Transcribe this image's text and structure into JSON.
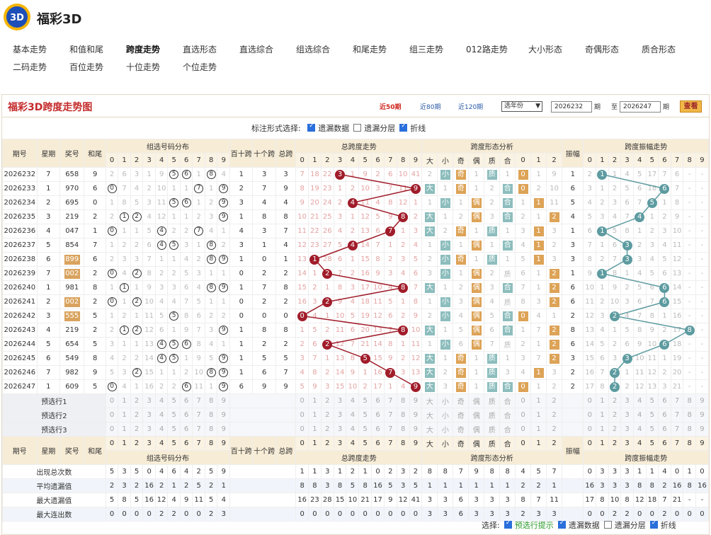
{
  "site": {
    "name": "福彩3D",
    "logo_label": "3D"
  },
  "nav": [
    [
      {
        "label": "基本走势"
      },
      {
        "label": "和值和尾"
      },
      {
        "label": "跨度走势",
        "active": true
      },
      {
        "label": "直选形态"
      },
      {
        "label": "直选综合"
      },
      {
        "label": "组选综合"
      },
      {
        "label": "和尾走势"
      },
      {
        "label": "组三走势"
      },
      {
        "label": "012路走势"
      },
      {
        "label": "大小形态"
      },
      {
        "label": "奇偶形态"
      },
      {
        "label": "质合形态"
      }
    ],
    [
      {
        "label": "二码走势"
      },
      {
        "label": "百位走势"
      },
      {
        "label": "十位走势"
      },
      {
        "label": "个位走势"
      }
    ]
  ],
  "panel": {
    "title": "福彩3D跨度走势图",
    "ranges": [
      "近50期",
      "近80期",
      "近120期"
    ],
    "active_range": "近50期",
    "year_select": "选年份",
    "from_issue": "2026232",
    "from_label": "期",
    "to_label": "至",
    "to_issue": "2026247",
    "to_suffix": "期",
    "view_btn": "查看",
    "mark_label": "标注形式选择:",
    "checks": [
      {
        "label": "遗漏数据",
        "checked": true
      },
      {
        "label": "遗漏分层",
        "checked": false
      },
      {
        "label": "折线",
        "checked": true
      }
    ]
  },
  "headers": {
    "issue": "期号",
    "week": "星期",
    "num": "奖号",
    "sumtail": "和尾",
    "group": "组选号码分布",
    "bs": "百十跨",
    "bg": "十个跨",
    "total": "总跨",
    "zkt": "总跨度走势",
    "shape": "跨度形态分析",
    "amp": "振幅",
    "ampt": "跨度振幅走势",
    "shape_cols": [
      "大",
      "小",
      "奇",
      "偶",
      "质",
      "合",
      "0",
      "1",
      "2"
    ],
    "digits": [
      "0",
      "1",
      "2",
      "3",
      "4",
      "5",
      "6",
      "7",
      "8",
      "9"
    ]
  },
  "rows": [
    {
      "issue": "2026232",
      "week": "7",
      "num": "658",
      "tail": "9",
      "grp": [
        "2",
        "6",
        "3",
        "1",
        "9",
        "⑤",
        "⑥",
        "1",
        "⑧",
        "4"
      ],
      "bs": "1",
      "bg": "3",
      "tot": "3",
      "zk": [
        "7",
        "18",
        "22",
        "●3",
        "1",
        "9",
        "2",
        "6",
        "10",
        "41"
      ],
      "shp": [
        "2",
        "小",
        "奇",
        "1",
        "质",
        "1",
        "0",
        "1",
        "9"
      ],
      "amp": "1",
      "ampz": [
        "2",
        "●1",
        "1",
        "4",
        "5",
        "17",
        "7",
        "6",
        "-",
        "-"
      ]
    },
    {
      "issue": "2026233",
      "week": "1",
      "num": "970",
      "tail": "6",
      "grp": [
        "⓪",
        "7",
        "4",
        "2",
        "10",
        "1",
        "1",
        "⑦",
        "1",
        "⑨"
      ],
      "bs": "2",
      "bg": "7",
      "tot": "9",
      "zk": [
        "8",
        "19",
        "23",
        "1",
        "2",
        "10",
        "3",
        "7",
        "11",
        "●9"
      ],
      "shp": [
        "大",
        "1",
        "奇",
        "1",
        "2",
        "合",
        "0",
        "2",
        "10"
      ],
      "amp": "6",
      "ampz": [
        "3",
        "1",
        "2",
        "5",
        "6",
        "18",
        "●6",
        "7",
        "-",
        "-"
      ]
    },
    {
      "issue": "2026234",
      "week": "2",
      "num": "695",
      "tail": "0",
      "grp": [
        "1",
        "8",
        "5",
        "3",
        "11",
        "⑤",
        "⑥",
        "1",
        "2",
        "⑨"
      ],
      "bs": "3",
      "bg": "4",
      "tot": "4",
      "zk": [
        "9",
        "20",
        "24",
        "2",
        "●4",
        "11",
        "4",
        "8",
        "12",
        "1"
      ],
      "shp": [
        "1",
        "小",
        "1",
        "偶",
        "2",
        "合",
        "1",
        "1",
        "11"
      ],
      "amp": "5",
      "ampz": [
        "4",
        "2",
        "3",
        "6",
        "7",
        "●5",
        "1",
        "8",
        "-",
        "-"
      ]
    },
    {
      "issue": "2026235",
      "week": "3",
      "num": "219",
      "tail": "2",
      "grp": [
        "2",
        "①",
        "②",
        "4",
        "12",
        "1",
        "1",
        "2",
        "3",
        "⑨"
      ],
      "bs": "1",
      "bg": "8",
      "tot": "8",
      "zk": [
        "10",
        "21",
        "25",
        "3",
        "1",
        "12",
        "5",
        "9",
        "●8",
        "2"
      ],
      "shp": [
        "大",
        "1",
        "2",
        "偶",
        "3",
        "合",
        "2",
        "1",
        "2"
      ],
      "amp": "4",
      "ampz": [
        "5",
        "3",
        "4",
        "7",
        "●4",
        "1",
        "2",
        "9",
        "-",
        "-"
      ]
    },
    {
      "issue": "2026236",
      "week": "4",
      "num": "047",
      "tail": "1",
      "grp": [
        "⓪",
        "1",
        "1",
        "5",
        "④",
        "2",
        "2",
        "⑦",
        "4",
        "1"
      ],
      "bs": "4",
      "bg": "3",
      "tot": "7",
      "zk": [
        "11",
        "22",
        "26",
        "4",
        "2",
        "13",
        "6",
        "●7",
        "1",
        "3"
      ],
      "shp": [
        "大",
        "2",
        "奇",
        "1",
        "质",
        "1",
        "3",
        "1",
        "3"
      ],
      "amp": "1",
      "ampz": [
        "6",
        "●1",
        "5",
        "8",
        "1",
        "2",
        "3",
        "10",
        "-",
        "-"
      ]
    },
    {
      "issue": "2026237",
      "week": "5",
      "num": "854",
      "tail": "7",
      "grp": [
        "1",
        "2",
        "2",
        "6",
        "④",
        "⑤",
        "3",
        "1",
        "⑧",
        "2"
      ],
      "bs": "3",
      "bg": "1",
      "tot": "4",
      "zk": [
        "12",
        "23",
        "27",
        "5",
        "●4",
        "14",
        "7",
        "1",
        "2",
        "4"
      ],
      "shp": [
        "1",
        "小",
        "1",
        "偶",
        "1",
        "合",
        "4",
        "1",
        "2"
      ],
      "amp": "3",
      "ampz": [
        "7",
        "1",
        "6",
        "●3",
        "2",
        "3",
        "4",
        "11",
        "-",
        "-"
      ]
    },
    {
      "issue": "2026238",
      "week": "6",
      "num": "899",
      "tail": "6",
      "grp": [
        "2",
        "3",
        "3",
        "7",
        "1",
        "1",
        "4",
        "2",
        "⑧",
        "⑨"
      ],
      "bs": "1",
      "bg": "0",
      "tot": "1",
      "zk": [
        "13",
        "●1",
        "28",
        "6",
        "1",
        "15",
        "8",
        "2",
        "3",
        "5"
      ],
      "shp": [
        "2",
        "小",
        "奇",
        "1",
        "质",
        "1",
        "5",
        "1",
        "3"
      ],
      "amp": "3",
      "ampz": [
        "8",
        "2",
        "7",
        "●3",
        "3",
        "4",
        "5",
        "12",
        "-",
        "-"
      ],
      "zu": true
    },
    {
      "issue": "2026239",
      "week": "7",
      "num": "002",
      "tail": "2",
      "grp": [
        "⓪",
        "4",
        "②",
        "8",
        "2",
        "2",
        "5",
        "3",
        "1",
        "1"
      ],
      "bs": "0",
      "bg": "2",
      "tot": "2",
      "zk": [
        "14",
        "1",
        "●2",
        "7",
        "2",
        "16",
        "9",
        "3",
        "4",
        "6"
      ],
      "shp": [
        "3",
        "小",
        "1",
        "偶",
        "2",
        "质",
        "6",
        "1",
        "2"
      ],
      "amp": "1",
      "ampz": [
        "9",
        "●1",
        "8",
        "1",
        "4",
        "5",
        "6",
        "13",
        "-",
        "-"
      ],
      "zu": true
    },
    {
      "issue": "2026240",
      "week": "1",
      "num": "981",
      "tail": "8",
      "grp": [
        "1",
        "①",
        "1",
        "9",
        "3",
        "3",
        "6",
        "4",
        "⑧",
        "⑨"
      ],
      "bs": "1",
      "bg": "7",
      "tot": "8",
      "zk": [
        "15",
        "2",
        "1",
        "8",
        "3",
        "17",
        "10",
        "4",
        "●8",
        "7"
      ],
      "shp": [
        "大",
        "1",
        "2",
        "偶",
        "3",
        "合",
        "7",
        "1",
        "2"
      ],
      "amp": "6",
      "ampz": [
        "10",
        "1",
        "9",
        "2",
        "5",
        "6",
        "●6",
        "14",
        "-",
        "-"
      ]
    },
    {
      "issue": "2026241",
      "week": "2",
      "num": "002",
      "tail": "2",
      "grp": [
        "⓪",
        "1",
        "②",
        "10",
        "4",
        "4",
        "7",
        "5",
        "1",
        "1"
      ],
      "bs": "0",
      "bg": "2",
      "tot": "2",
      "zk": [
        "16",
        "3",
        "●2",
        "9",
        "4",
        "18",
        "11",
        "5",
        "1",
        "8"
      ],
      "shp": [
        "1",
        "小",
        "3",
        "偶",
        "4",
        "质",
        "8",
        "3",
        "2"
      ],
      "amp": "6",
      "ampz": [
        "11",
        "2",
        "10",
        "3",
        "6",
        "7",
        "●6",
        "15",
        "-",
        "-"
      ],
      "zu": true
    },
    {
      "issue": "2026242",
      "week": "3",
      "num": "555",
      "tail": "5",
      "grp": [
        "1",
        "2",
        "1",
        "11",
        "5",
        "⑤",
        "8",
        "6",
        "2",
        "2"
      ],
      "bs": "0",
      "bg": "0",
      "tot": "0",
      "zk": [
        "●0",
        "4",
        "1",
        "10",
        "5",
        "19",
        "12",
        "6",
        "2",
        "9"
      ],
      "shp": [
        "2",
        "小",
        "4",
        "偶",
        "5",
        "合",
        "0",
        "4",
        "1"
      ],
      "amp": "2",
      "ampz": [
        "12",
        "3",
        "●2",
        "4",
        "7",
        "8",
        "1",
        "16",
        "-",
        "-"
      ],
      "zu": true
    },
    {
      "issue": "2026243",
      "week": "4",
      "num": "219",
      "tail": "2",
      "grp": [
        "2",
        "①",
        "②",
        "12",
        "6",
        "1",
        "9",
        "7",
        "3",
        "⑨"
      ],
      "bs": "1",
      "bg": "8",
      "tot": "8",
      "zk": [
        "1",
        "5",
        "2",
        "11",
        "6",
        "20",
        "13",
        "7",
        "●8",
        "10"
      ],
      "shp": [
        "大",
        "1",
        "5",
        "偶",
        "6",
        "合",
        "1",
        "7",
        "2"
      ],
      "amp": "8",
      "ampz": [
        "13",
        "4",
        "1",
        "5",
        "8",
        "9",
        "2",
        "17",
        "●8",
        "-"
      ]
    },
    {
      "issue": "2026244",
      "week": "5",
      "num": "654",
      "tail": "5",
      "grp": [
        "3",
        "1",
        "1",
        "13",
        "④",
        "⑤",
        "⑥",
        "8",
        "4",
        "1"
      ],
      "bs": "1",
      "bg": "2",
      "tot": "2",
      "zk": [
        "2",
        "6",
        "●2",
        "12",
        "7",
        "21",
        "14",
        "8",
        "1",
        "11"
      ],
      "shp": [
        "1",
        "小",
        "6",
        "偶",
        "7",
        "质",
        "2",
        "1",
        "2"
      ],
      "amp": "6",
      "ampz": [
        "14",
        "5",
        "2",
        "6",
        "9",
        "10",
        "●6",
        "18",
        "-",
        "-"
      ]
    },
    {
      "issue": "2026245",
      "week": "6",
      "num": "549",
      "tail": "8",
      "grp": [
        "4",
        "2",
        "2",
        "14",
        "④",
        "⑤",
        "1",
        "9",
        "5",
        "⑨"
      ],
      "bs": "1",
      "bg": "5",
      "tot": "5",
      "zk": [
        "3",
        "7",
        "1",
        "13",
        "8",
        "●5",
        "15",
        "9",
        "2",
        "12"
      ],
      "shp": [
        "大",
        "1",
        "奇",
        "1",
        "质",
        "1",
        "3",
        "7",
        "2"
      ],
      "amp": "3",
      "ampz": [
        "15",
        "6",
        "3",
        "●3",
        "10",
        "11",
        "1",
        "19",
        "-",
        "-"
      ]
    },
    {
      "issue": "2026246",
      "week": "7",
      "num": "982",
      "tail": "9",
      "grp": [
        "5",
        "3",
        "②",
        "15",
        "1",
        "1",
        "2",
        "10",
        "⑧",
        "⑨"
      ],
      "bs": "1",
      "bg": "6",
      "tot": "7",
      "zk": [
        "4",
        "8",
        "2",
        "14",
        "9",
        "1",
        "16",
        "●7",
        "3",
        "13"
      ],
      "shp": [
        "大",
        "2",
        "奇",
        "1",
        "质",
        "3",
        "4",
        "1",
        "3"
      ],
      "amp": "2",
      "ampz": [
        "16",
        "7",
        "●2",
        "1",
        "11",
        "12",
        "2",
        "20",
        "-",
        "-"
      ]
    },
    {
      "issue": "2026247",
      "week": "1",
      "num": "609",
      "tail": "5",
      "grp": [
        "⓪",
        "4",
        "1",
        "16",
        "2",
        "2",
        "⑥",
        "11",
        "1",
        "⑨"
      ],
      "bs": "6",
      "bg": "9",
      "tot": "9",
      "zk": [
        "5",
        "9",
        "3",
        "15",
        "10",
        "2",
        "17",
        "1",
        "4",
        "●9"
      ],
      "shp": [
        "大",
        "3",
        "奇",
        "1",
        "质",
        "合",
        "0",
        "1",
        "2"
      ],
      "amp": "2",
      "ampz": [
        "17",
        "8",
        "●2",
        "2",
        "12",
        "13",
        "3",
        "21",
        "-",
        "-"
      ]
    }
  ],
  "predict": [
    "预选行1",
    "预选行2",
    "预选行3"
  ],
  "stats": [
    {
      "label": "出现总次数",
      "grp": [
        "5",
        "3",
        "5",
        "0",
        "4",
        "6",
        "4",
        "2",
        "5",
        "9"
      ],
      "zk": [
        "1",
        "1",
        "3",
        "1",
        "2",
        "1",
        "0",
        "2",
        "3",
        "2"
      ],
      "shp": [
        "8",
        "8",
        "7",
        "9",
        "8",
        "8",
        "4",
        "5",
        "7"
      ],
      "ampz": [
        "0",
        "3",
        "3",
        "3",
        "1",
        "1",
        "4",
        "0",
        "1",
        "0"
      ]
    },
    {
      "label": "平均遗漏值",
      "grp": [
        "2",
        "3",
        "2",
        "16",
        "2",
        "1",
        "2",
        "5",
        "2",
        "1"
      ],
      "zk": [
        "8",
        "8",
        "3",
        "8",
        "5",
        "8",
        "16",
        "5",
        "3",
        "5"
      ],
      "shp": [
        "1",
        "1",
        "1",
        "1",
        "1",
        "1",
        "2",
        "2",
        "1"
      ],
      "ampz": [
        "16",
        "3",
        "3",
        "3",
        "8",
        "8",
        "2",
        "16",
        "8",
        "16"
      ]
    },
    {
      "label": "最大遗漏值",
      "grp": [
        "5",
        "8",
        "5",
        "16",
        "12",
        "4",
        "9",
        "11",
        "5",
        "4"
      ],
      "zk": [
        "16",
        "23",
        "28",
        "15",
        "10",
        "21",
        "17",
        "9",
        "12",
        "41"
      ],
      "shp": [
        "3",
        "3",
        "6",
        "3",
        "3",
        "3",
        "8",
        "7",
        "11"
      ],
      "ampz": [
        "17",
        "8",
        "10",
        "8",
        "12",
        "18",
        "7",
        "21",
        "-",
        "-"
      ]
    },
    {
      "label": "最大连出数",
      "grp": [
        "0",
        "0",
        "0",
        "0",
        "2",
        "2",
        "0",
        "0",
        "2",
        "3"
      ],
      "zk": [
        "0",
        "0",
        "0",
        "0",
        "0",
        "0",
        "0",
        "0",
        "0",
        "0"
      ],
      "shp": [
        "3",
        "3",
        "6",
        "3",
        "3",
        "3",
        "2",
        "3",
        "3"
      ],
      "ampz": [
        "0",
        "0",
        "2",
        "2",
        "0",
        "0",
        "2",
        "0",
        "0",
        "0"
      ]
    }
  ],
  "footer": {
    "label": "选择:",
    "items": [
      {
        "label": "预选行提示",
        "checked": true,
        "green": true
      },
      {
        "label": "遗漏数据",
        "checked": true
      },
      {
        "label": "遗漏分层",
        "checked": false
      },
      {
        "label": "折线",
        "checked": true
      }
    ]
  },
  "colors": {
    "accent_red": "#c52b2b",
    "ball_red": "#a01c2a",
    "ball_teal": "#5d9ba0",
    "header_bg": "#f7ecd6",
    "shape_box": "#8dbdbd",
    "odd_box": "#dda357"
  }
}
